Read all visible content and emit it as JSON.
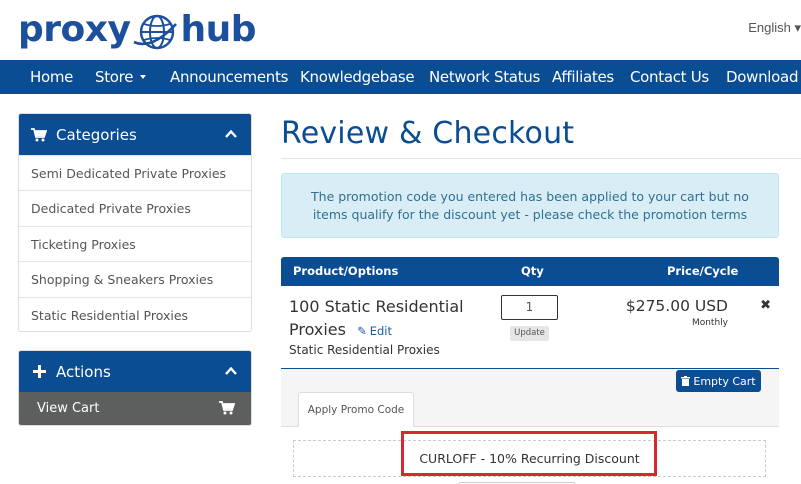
{
  "header": {
    "logo_left": "proxy",
    "logo_right": "hub",
    "language": "English ▾"
  },
  "nav": {
    "items": [
      "Home",
      "Store",
      "Announcements",
      "Knowledgebase",
      "Network Status",
      "Affiliates",
      "Contact Us",
      "Download Y"
    ]
  },
  "sidebar": {
    "categories_title": "Categories",
    "categories": [
      "Semi Dedicated Private Proxies",
      "Dedicated Private Proxies",
      "Ticketing Proxies",
      "Shopping & Sneakers Proxies",
      "Static Residential Proxies"
    ],
    "actions_title": "Actions",
    "view_cart": "View Cart"
  },
  "main": {
    "title": "Review & Checkout",
    "alert": "The promotion code you entered has been applied to your cart but no items qualify for the discount yet - please check the promotion terms",
    "table": {
      "col_product": "Product/Options",
      "col_qty": "Qty",
      "col_price": "Price/Cycle"
    },
    "item": {
      "name": "100 Static Residential Proxies",
      "edit": "Edit",
      "group": "Static Residential Proxies",
      "qty": "1",
      "update": "Update",
      "price": "$275.00 USD",
      "cycle": "Monthly",
      "remove": "✖"
    },
    "empty_cart": "Empty Cart",
    "promo_tab": "Apply Promo Code",
    "promo_applied": "CURLOFF - 10% Recurring Discount"
  },
  "colors": {
    "brand": "#0a4d93",
    "logo": "#1c4f9c",
    "alert_bg": "#d9edf7",
    "alert_text": "#31708f",
    "highlight": "#d7282f"
  },
  "icons": [
    "globe-icon",
    "cart-icon",
    "chevron-up-icon",
    "plus-icon",
    "pencil-icon",
    "remove-icon",
    "trash-icon",
    "caret-down-icon"
  ]
}
